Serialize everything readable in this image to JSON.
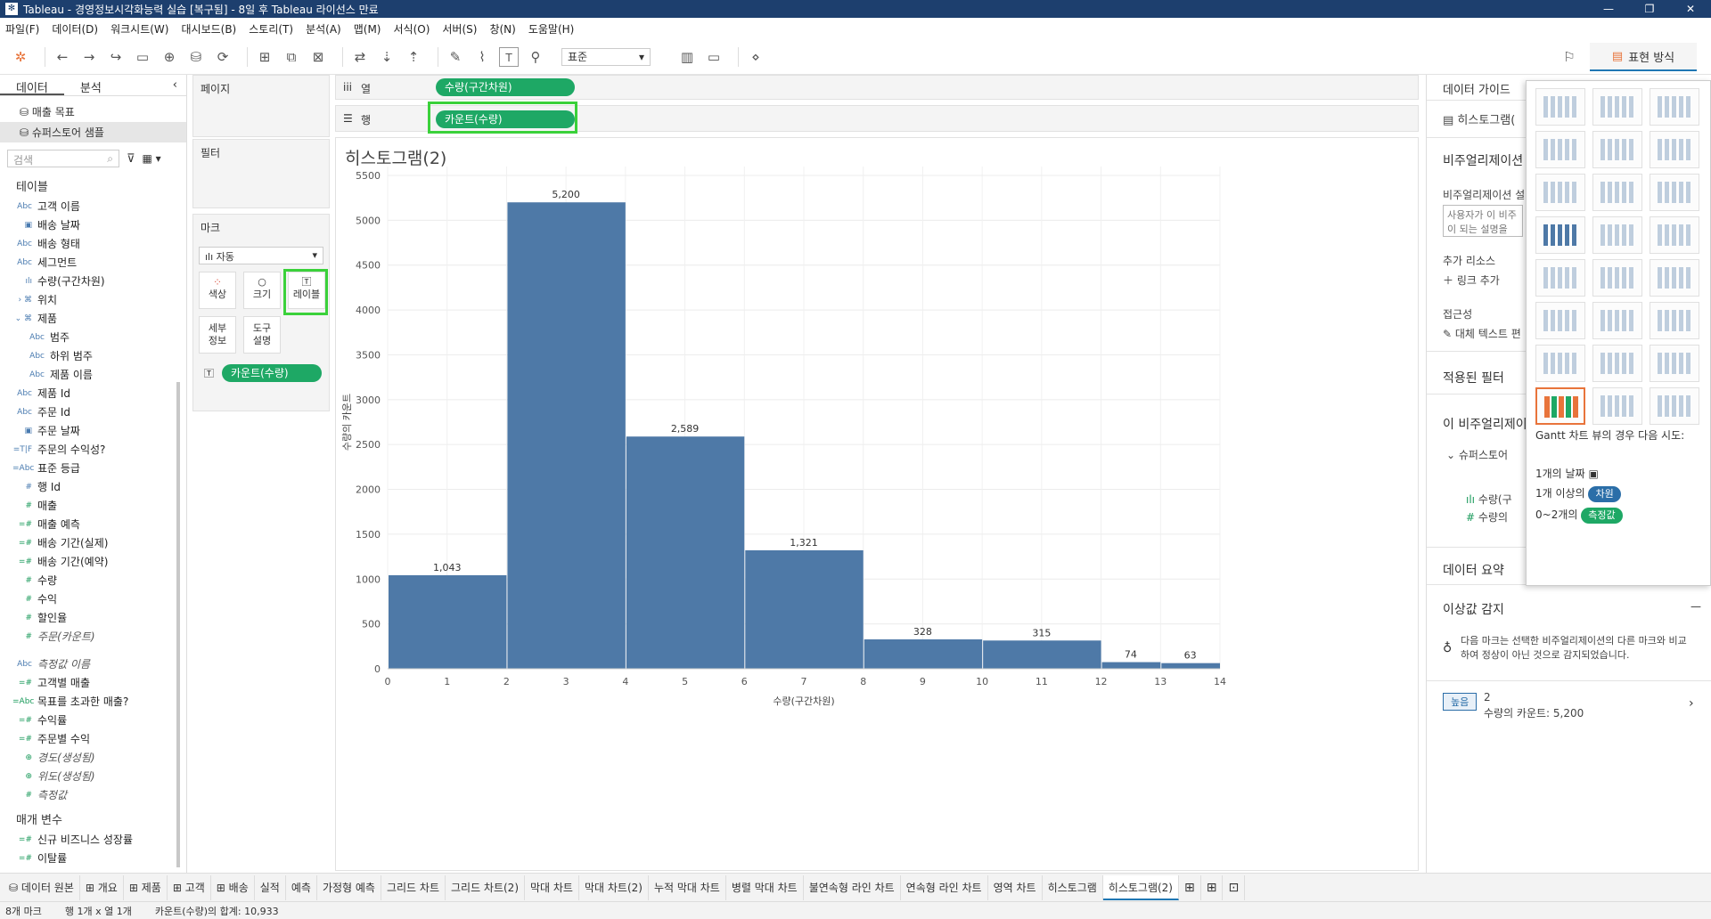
{
  "window": {
    "title": "Tableau - 경영정보시각화능력 실습 [복구됨] - 8일 후 Tableau 라이선스 만료"
  },
  "menu": [
    "파일(F)",
    "데이터(D)",
    "워크시트(W)",
    "대시보드(B)",
    "스토리(T)",
    "분석(A)",
    "맵(M)",
    "서식(O)",
    "서버(S)",
    "창(N)",
    "도움말(H)"
  ],
  "toolbar": {
    "fit": "표준",
    "showme_label": "표현 방식"
  },
  "datapane": {
    "tabs": [
      "데이터",
      "분석"
    ],
    "sources": [
      "매출 목표",
      "슈퍼스토어 샘플"
    ],
    "search_placeholder": "검색",
    "tables_title": "테이블",
    "fields": [
      {
        "icon": "Abc",
        "label": "고객 이름",
        "indent": 0,
        "green": false,
        "italic": false
      },
      {
        "icon": "▣",
        "label": "배송 날짜",
        "indent": 0,
        "green": false,
        "italic": false
      },
      {
        "icon": "Abc",
        "label": "배송 형태",
        "indent": 0,
        "green": false,
        "italic": false
      },
      {
        "icon": "Abc",
        "label": "세그먼트",
        "indent": 0,
        "green": false,
        "italic": false
      },
      {
        "icon": "ılı",
        "label": "수량(구간차원)",
        "indent": 0,
        "green": false,
        "italic": false
      },
      {
        "icon": "›  ⌘",
        "label": "위치",
        "indent": 0,
        "green": false,
        "italic": false
      },
      {
        "icon": "⌄  ⌘",
        "label": "제품",
        "indent": 0,
        "green": false,
        "italic": false
      },
      {
        "icon": "Abc",
        "label": "범주",
        "indent": 1,
        "green": false,
        "italic": false
      },
      {
        "icon": "Abc",
        "label": "하위 범주",
        "indent": 1,
        "green": false,
        "italic": false
      },
      {
        "icon": "Abc",
        "label": "제품 이름",
        "indent": 1,
        "green": false,
        "italic": false
      },
      {
        "icon": "Abc",
        "label": "제품 Id",
        "indent": 0,
        "green": false,
        "italic": false
      },
      {
        "icon": "Abc",
        "label": "주문 Id",
        "indent": 0,
        "green": false,
        "italic": false
      },
      {
        "icon": "▣",
        "label": "주문 날짜",
        "indent": 0,
        "green": false,
        "italic": false
      },
      {
        "icon": "=T|F",
        "label": "주문의 수익성?",
        "indent": 0,
        "green": false,
        "italic": false
      },
      {
        "icon": "=Abc",
        "label": "표준 등급",
        "indent": 0,
        "green": false,
        "italic": false
      },
      {
        "icon": "#",
        "label": "행 Id",
        "indent": 0,
        "green": false,
        "italic": false
      },
      {
        "icon": "#",
        "label": "매출",
        "indent": 0,
        "green": true,
        "italic": false
      },
      {
        "icon": "=#",
        "label": "매출 예측",
        "indent": 0,
        "green": true,
        "italic": false
      },
      {
        "icon": "=#",
        "label": "배송 기간(실제)",
        "indent": 0,
        "green": true,
        "italic": false
      },
      {
        "icon": "=#",
        "label": "배송 기간(예약)",
        "indent": 0,
        "green": true,
        "italic": false
      },
      {
        "icon": "#",
        "label": "수량",
        "indent": 0,
        "green": true,
        "italic": false
      },
      {
        "icon": "#",
        "label": "수익",
        "indent": 0,
        "green": true,
        "italic": false
      },
      {
        "icon": "#",
        "label": "할인율",
        "indent": 0,
        "green": true,
        "italic": false
      },
      {
        "icon": "#",
        "label": "주문(카운트)",
        "indent": 0,
        "green": true,
        "italic": true
      }
    ],
    "extra_fields": [
      {
        "icon": "Abc",
        "label": "측정값 이름",
        "green": false,
        "italic": true
      },
      {
        "icon": "=#",
        "label": "고객별 매출",
        "green": true,
        "italic": false
      },
      {
        "icon": "=Abc",
        "label": "목표를 초과한 매출?",
        "green": true,
        "italic": false
      },
      {
        "icon": "=#",
        "label": "수익률",
        "green": true,
        "italic": false
      },
      {
        "icon": "=#",
        "label": "주문별 수익",
        "green": true,
        "italic": false
      },
      {
        "icon": "⊕",
        "label": "경도(생성됨)",
        "green": true,
        "italic": true
      },
      {
        "icon": "⊕",
        "label": "위도(생성됨)",
        "green": true,
        "italic": true
      },
      {
        "icon": "#",
        "label": "측정값",
        "green": true,
        "italic": true
      }
    ],
    "params_title": "매개 변수",
    "params": [
      {
        "icon": "=#",
        "label": "신규 비즈니스 성장률"
      },
      {
        "icon": "=#",
        "label": "이탈률"
      }
    ]
  },
  "cards": {
    "pages": "페이지",
    "filters": "필터",
    "marks": "마크",
    "mark_type": "자동",
    "mark_buttons": [
      "색상",
      "크기",
      "레이블",
      "세부\n정보",
      "도구\n설명"
    ],
    "mark_pill": "카운트(수량)"
  },
  "shelves": {
    "columns_label": "열",
    "rows_label": "행",
    "columns_pill": "수량(구간차원)",
    "rows_pill": "카운트(수량)"
  },
  "sheet_title": "히스토그램(2)",
  "chart_data": {
    "type": "bar",
    "title": "히스토그램(2)",
    "xlabel": "수량(구간차원)",
    "ylabel": "수량의 카운트",
    "bin_starts": [
      0,
      2,
      4,
      6,
      8,
      10,
      12
    ],
    "bin_width": 2,
    "values": [
      1043,
      5200,
      2589,
      1321,
      328,
      315,
      74,
      63
    ],
    "value_labels": [
      "1,043",
      "5,200",
      "2,589",
      "1,321",
      "328",
      "315",
      "74",
      "63"
    ],
    "bins": [
      0,
      2,
      4,
      6,
      8,
      10,
      12,
      13
    ],
    "xlim": [
      0,
      14
    ],
    "ylim": [
      0,
      5500
    ],
    "yticks": [
      "0",
      "500",
      "1000",
      "1500",
      "2000",
      "2500",
      "3000",
      "3500",
      "4000",
      "4500",
      "5000",
      "5500"
    ],
    "xticks": [
      "0",
      "1",
      "2",
      "3",
      "4",
      "5",
      "6",
      "7",
      "8",
      "9",
      "10",
      "11",
      "12",
      "13",
      "14"
    ],
    "bar_color": "#4e79a7",
    "grid": true
  },
  "rightpanel": {
    "title": "데이터 가이드",
    "sheet": "히스토그램(",
    "viz_title": "비주얼리제이션",
    "viz_desc_label": "비주얼리제이션 설",
    "viz_desc_text": "사용자가 이 비주\n이 되는 설명을 입",
    "resources": "추가 리소스",
    "add_link": "링크 추가",
    "accessibility": "접근성",
    "alt_text": "대체 텍스트 편",
    "applied_filters": "적용된 필터",
    "this_viz": "이 비주얼리제이",
    "datasource_item": "슈퍼스토어",
    "item1": "수량(구",
    "item2": "수량의",
    "data_summary": "데이터 요약",
    "outliers_title": "이상값 감지",
    "outliers_desc": "다음 마크는 선택한 비주얼리제이션의 다른 마크와 비교하여 정상이 아닌 것으로 감지되었습니다.",
    "high_badge": "높음",
    "outlier_count": "2",
    "outlier_detail": "수량의 카운트: 5,200"
  },
  "showme": {
    "hint": "Gantt 차트 뷰의 경우 다음 시도:",
    "req1": "1개의 날짜",
    "req2_prefix": "1개 이상의",
    "req2_badge": "차원",
    "req3_prefix": "0~2개의",
    "req3_badge": "측정값",
    "dim_color": "#2b6ea8",
    "meas_color": "#1ea865"
  },
  "tabs": [
    "데이터 원본",
    "개요",
    "제품",
    "고객",
    "배송",
    "실적",
    "예측",
    "가정형 예측",
    "그리드 차트",
    "그리드 차트(2)",
    "막대 차트",
    "막대 차트(2)",
    "누적 막대 차트",
    "병렬 막대 차트",
    "불연속형 라인 차트",
    "연속형 라인 차트",
    "영역 차트",
    "히스토그램",
    "히스토그램(2)"
  ],
  "status": {
    "marks": "8개 마크",
    "rows_cols": "행 1개 x 열 1개",
    "sum": "카운트(수량)의 합계: 10,933"
  }
}
